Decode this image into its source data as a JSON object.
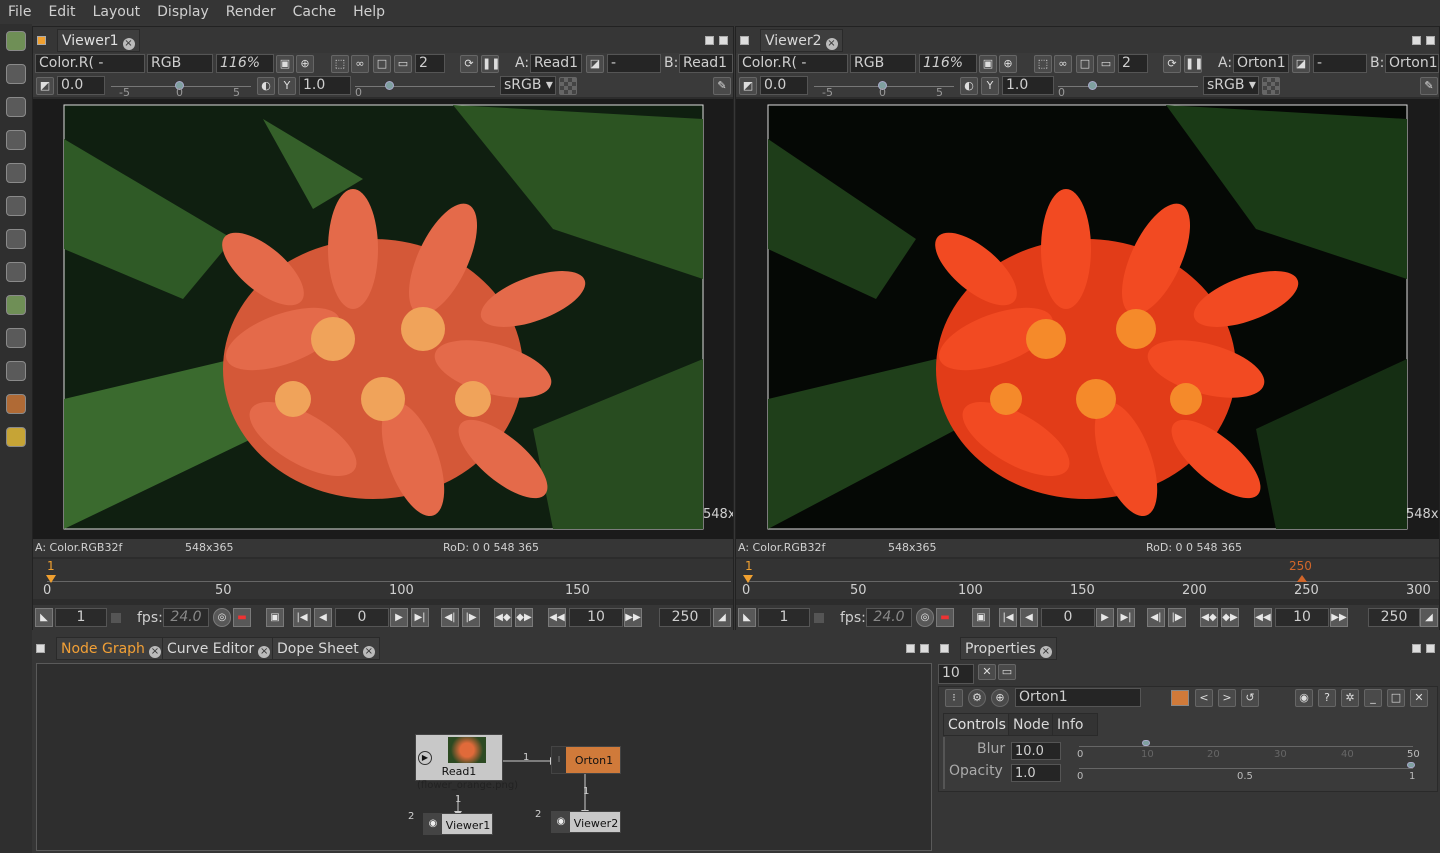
{
  "menu": [
    "File",
    "Edit",
    "Layout",
    "Display",
    "Render",
    "Cache",
    "Help"
  ],
  "toolbar_icons": [
    "time-icon",
    "image-icon",
    "channel-icon",
    "color-icon",
    "filter-icon",
    "transform-icon",
    "keyer-icon",
    "merge-icon",
    "paint-icon",
    "views-icon",
    "other-icon",
    "ofx-icon",
    "extra-icon"
  ],
  "viewer1": {
    "tab": "Viewer1",
    "layer": "Color.R(",
    "layer_dash": "-",
    "channels": "RGB",
    "zoom": "116%",
    "proxy": "2",
    "input_a_label": "A:",
    "input_a": "Read1",
    "input_mid": "-",
    "input_b_label": "B:",
    "input_b": "Read1",
    "gain": "0.0",
    "gain_ticks": [
      "-5",
      "0",
      "5"
    ],
    "y_label": "Y",
    "gamma": "1.0",
    "gamma_tick": "0",
    "colorspace": "sRGB",
    "edge_label": "548x",
    "status_left": "A: Color.RGB32f",
    "status_res": "548x365",
    "status_rod": "RoD: 0 0 548 365",
    "timeline_ticks": [
      "0",
      "50",
      "100",
      "150"
    ],
    "playhead": "1",
    "frame_start": "1",
    "fps_label": "fps:",
    "fps": "24.0",
    "current_frame": "0",
    "skip": "10",
    "frame_end": "250"
  },
  "viewer2": {
    "tab": "Viewer2",
    "layer": "Color.R(",
    "layer_dash": "-",
    "channels": "RGB",
    "zoom": "116%",
    "proxy": "2",
    "input_a_label": "A:",
    "input_a": "Orton1",
    "input_mid": "-",
    "input_b_label": "B:",
    "input_b": "Orton1",
    "gain": "0.0",
    "gain_ticks": [
      "-5",
      "0",
      "5"
    ],
    "y_label": "Y",
    "gamma": "1.0",
    "gamma_tick": "0",
    "colorspace": "sRGB",
    "edge_label": "548x",
    "status_left": "A: Color.RGB32f",
    "status_res": "548x365",
    "status_rod": "RoD: 0 0 548 365",
    "timeline_ticks": [
      "0",
      "50",
      "100",
      "150",
      "200",
      "250",
      "300"
    ],
    "playhead": "1",
    "end_marker": "250",
    "frame_start": "1",
    "fps_label": "fps:",
    "fps": "24.0",
    "current_frame": "0",
    "skip": "10",
    "frame_end": "250"
  },
  "bottom_tabs": [
    "Node Graph",
    "Curve Editor",
    "Dope Sheet"
  ],
  "nodes": {
    "read": "Read1",
    "read_file": "(flower_orange.png)",
    "orton": "Orton1",
    "viewer1": "Viewer1",
    "viewer2": "Viewer2",
    "edge_labels": [
      "1",
      "1",
      "2",
      "1",
      "2"
    ]
  },
  "properties": {
    "tab": "Properties",
    "max_panels": "10",
    "node_name": "Orton1",
    "tabs": [
      "Controls",
      "Node",
      "Info"
    ],
    "blur_label": "Blur",
    "blur_value": "10.0",
    "blur_ticks": [
      "0",
      "10",
      "20",
      "30",
      "40",
      "50"
    ],
    "opacity_label": "Opacity",
    "opacity_value": "1.0",
    "opacity_ticks": [
      "0",
      "0.5",
      "1"
    ],
    "node_color": "#d07a3a"
  }
}
